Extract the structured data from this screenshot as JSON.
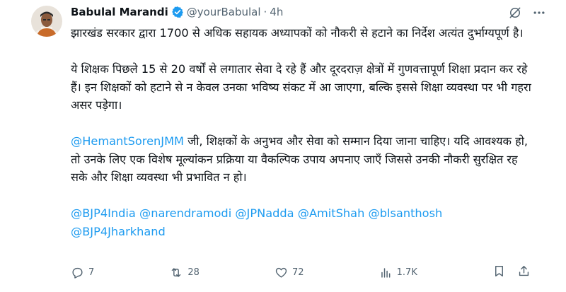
{
  "author": {
    "display_name": "Babulal Marandi",
    "handle": "@yourBabulal",
    "separator": "·",
    "time": "4h"
  },
  "content": {
    "p1": "झारखंड सरकार द्वारा 1700 से अधिक सहायक अध्यापकों को नौकरी से हटाने का निर्देश अत्यंत दुर्भाग्यपूर्ण है।",
    "p2": "ये शिक्षक पिछले 15 से 20 वर्षों से लगातार सेवा दे रहे हैं और दूरदराज़ क्षेत्रों में गुणवत्तापूर्ण शिक्षा प्रदान कर रहे हैं। इन शिक्षकों को हटाने से न केवल उनका भविष्य संकट में आ जाएगा, बल्कि इससे शिक्षा व्यवस्था पर भी गहरा असर पड़ेगा।",
    "p3_mention": "@HemantSorenJMM",
    "p3_text": " जी, शिक्षकों के अनुभव और सेवा को सम्मान दिया जाना चाहिए। यदि आवश्यक हो, तो उनके लिए एक विशेष मूल्यांकन प्रक्रिया या वैकल्पिक उपाय अपनाए जाएँ जिससे उनकी नौकरी सुरक्षित रह सके और शिक्षा व्यवस्था भी प्रभावित न हो।",
    "mentions": [
      "@BJP4India",
      "@narendramodi",
      "@JPNadda",
      "@AmitShah",
      "@blsanthosh",
      "@BJP4Jharkhand"
    ]
  },
  "actions": {
    "replies": "7",
    "reposts": "28",
    "likes": "72",
    "views": "1.7K"
  },
  "colors": {
    "accent": "#1d9bf0",
    "muted": "#536471",
    "text": "#0f1419"
  },
  "icons": [
    "verified-badge-icon",
    "grok-icon",
    "more-icon",
    "reply-icon",
    "repost-icon",
    "like-icon",
    "views-icon",
    "bookmark-icon",
    "share-icon"
  ]
}
